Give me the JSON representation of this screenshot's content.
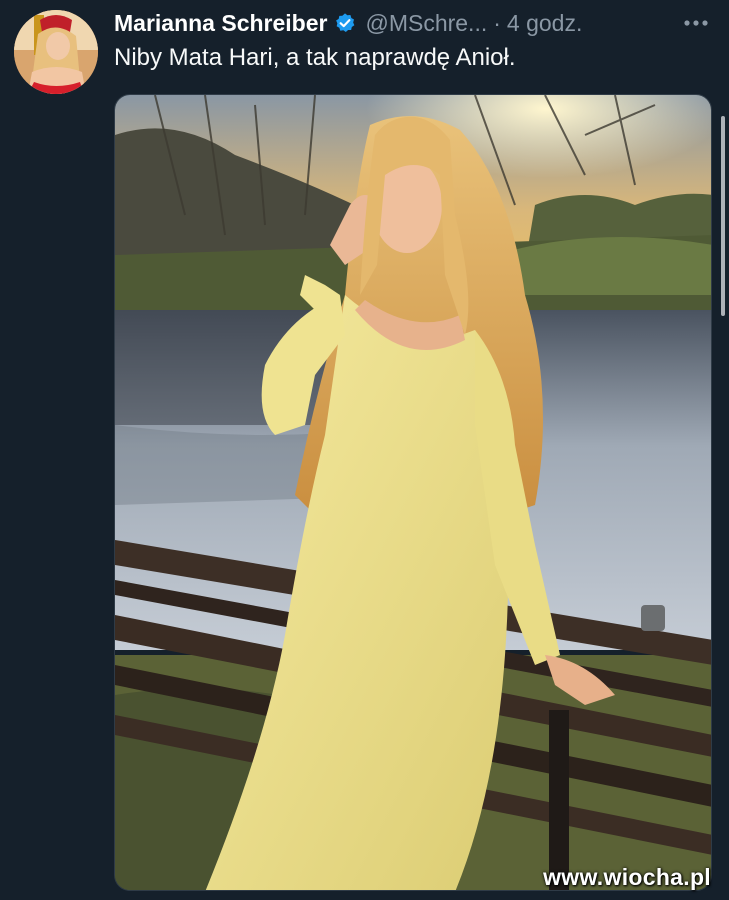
{
  "tweet": {
    "author_name": "Marianna Schreiber",
    "handle": "@MSchre...",
    "separator": "·",
    "time": "4 godz.",
    "text": "Niby Mata Hari, a tak naprawdę Anioł.",
    "verified": true
  },
  "icons": {
    "verified": "verified-badge-icon",
    "more": "more-options-icon"
  },
  "colors": {
    "background": "#15202b",
    "verified_blue": "#1d9bf0",
    "secondary_text": "#8b98a5",
    "dress_yellow": "#f2e79a"
  },
  "watermark": "www.wiocha.pl"
}
